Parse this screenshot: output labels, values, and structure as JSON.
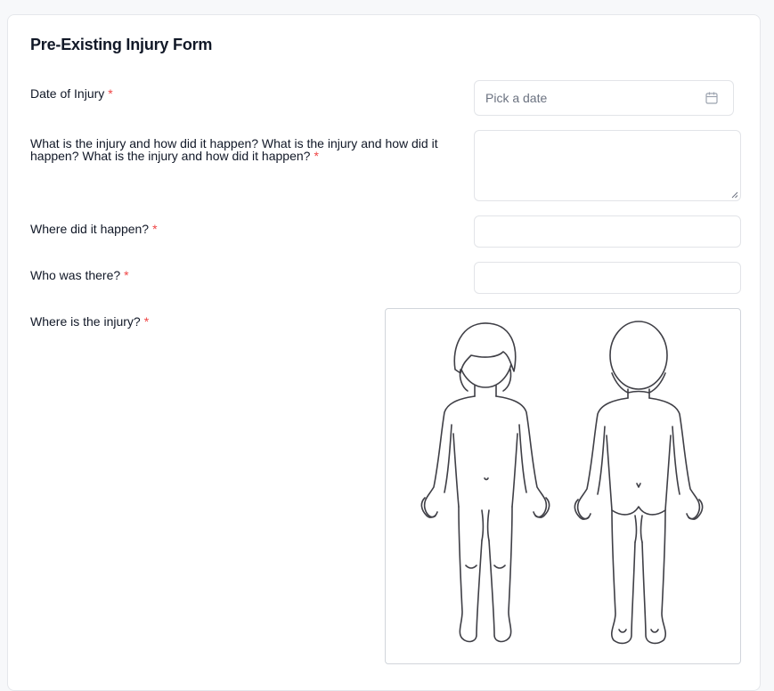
{
  "form": {
    "title": "Pre-Existing Injury Form",
    "required_marker": "*",
    "fields": {
      "date_of_injury": {
        "label": "Date of Injury",
        "placeholder": "Pick a date",
        "icon": "calendar-icon"
      },
      "injury_description": {
        "label": "What is the injury and how did it happen? What is the injury and how did it happen? What is the injury and how did it happen?",
        "value": ""
      },
      "where_happened": {
        "label": "Where did it happen?",
        "value": ""
      },
      "who_was_there": {
        "label": "Who was there?",
        "value": ""
      },
      "injury_location": {
        "label": "Where is the injury?",
        "diagram": "body-diagram-front-back"
      }
    }
  },
  "colors": {
    "required": "#ef4444",
    "border": "#e2e4e8",
    "placeholder": "#6b7280",
    "text": "#111827"
  }
}
